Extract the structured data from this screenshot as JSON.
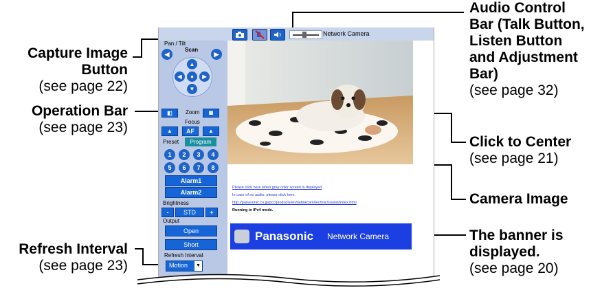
{
  "callouts": {
    "capture": {
      "title": "Capture Image Button",
      "ref": "(see page 22)"
    },
    "operation": {
      "title": "Operation Bar",
      "ref": "(see page 23)"
    },
    "refresh": {
      "title": "Refresh Interval",
      "ref": "(see page 23)"
    },
    "audio": {
      "title": "Audio Control Bar (Talk Button, Listen Button and Adjustment Bar)",
      "ref": "(see page 32)"
    },
    "click_center": {
      "title": "Click to Center",
      "ref": "(see page 21)"
    },
    "camera_image": {
      "title": "Camera Image"
    },
    "banner_note": {
      "title": "The banner is displayed.",
      "ref": "(see page 20)"
    }
  },
  "screen": {
    "topbar_title": "Network Camera",
    "pan_tilt_label": "Pan / Tilt",
    "scan_label": "Scan",
    "zoom_label": "Zoom",
    "focus_label": "Focus",
    "af_label": "AF",
    "preset_tab": "Preset",
    "program_tab": "Program",
    "presets": [
      "1",
      "2",
      "3",
      "4",
      "5",
      "6",
      "7",
      "8"
    ],
    "alarm1": "Alarm1",
    "alarm2": "Alarm2",
    "brightness_label": "Brightness",
    "brightness_value": "STD",
    "brightness_minus": "-",
    "brightness_plus": "+",
    "output_label": "Output",
    "open_label": "Open",
    "short_label": "Short",
    "refresh_label": "Refresh Interval",
    "refresh_value": "Motion",
    "link_gray": "Please click here when gray color screen is displayed",
    "link_audio": "In case of no audio, please click here.",
    "link_url": "http://panasonic.co.jp/pcc/products/en/netwkcam/technic/sound/index.html",
    "ipv4_status": "Running in IPv4 mode.",
    "banner_brand": "Panasonic",
    "banner_text": "Network Camera"
  },
  "colors": {
    "accent": "#1565d6",
    "sidebar": "#b9c8e4",
    "banner": "#1b3fe0"
  }
}
